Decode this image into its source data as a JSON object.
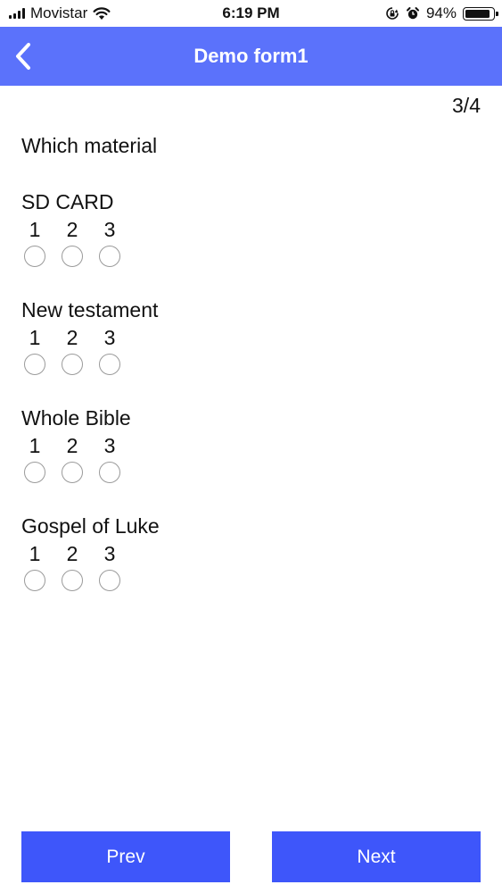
{
  "status_bar": {
    "carrier": "Movistar",
    "time": "6:19 PM",
    "battery_percent": "94%",
    "battery_level": 0.94
  },
  "header": {
    "title": "Demo form1"
  },
  "form": {
    "page_indicator": "3/4",
    "question": "Which material",
    "items": [
      {
        "label": "SD CARD",
        "options": [
          "1",
          "2",
          "3"
        ]
      },
      {
        "label": "New testament",
        "options": [
          "1",
          "2",
          "3"
        ]
      },
      {
        "label": "Whole Bible",
        "options": [
          "1",
          "2",
          "3"
        ]
      },
      {
        "label": "Gospel of Luke",
        "options": [
          "1",
          "2",
          "3"
        ]
      }
    ]
  },
  "footer": {
    "prev_label": "Prev",
    "next_label": "Next"
  },
  "colors": {
    "header_bg": "#5b72fb",
    "button_bg": "#3e56fa",
    "radio_border": "#9a9a9a"
  },
  "icons": {
    "back": "chevron-left-icon",
    "signal": "signal-bars-icon",
    "wifi": "wifi-icon",
    "orientation_lock": "orientation-lock-icon",
    "alarm": "alarm-clock-icon",
    "battery": "battery-icon"
  }
}
